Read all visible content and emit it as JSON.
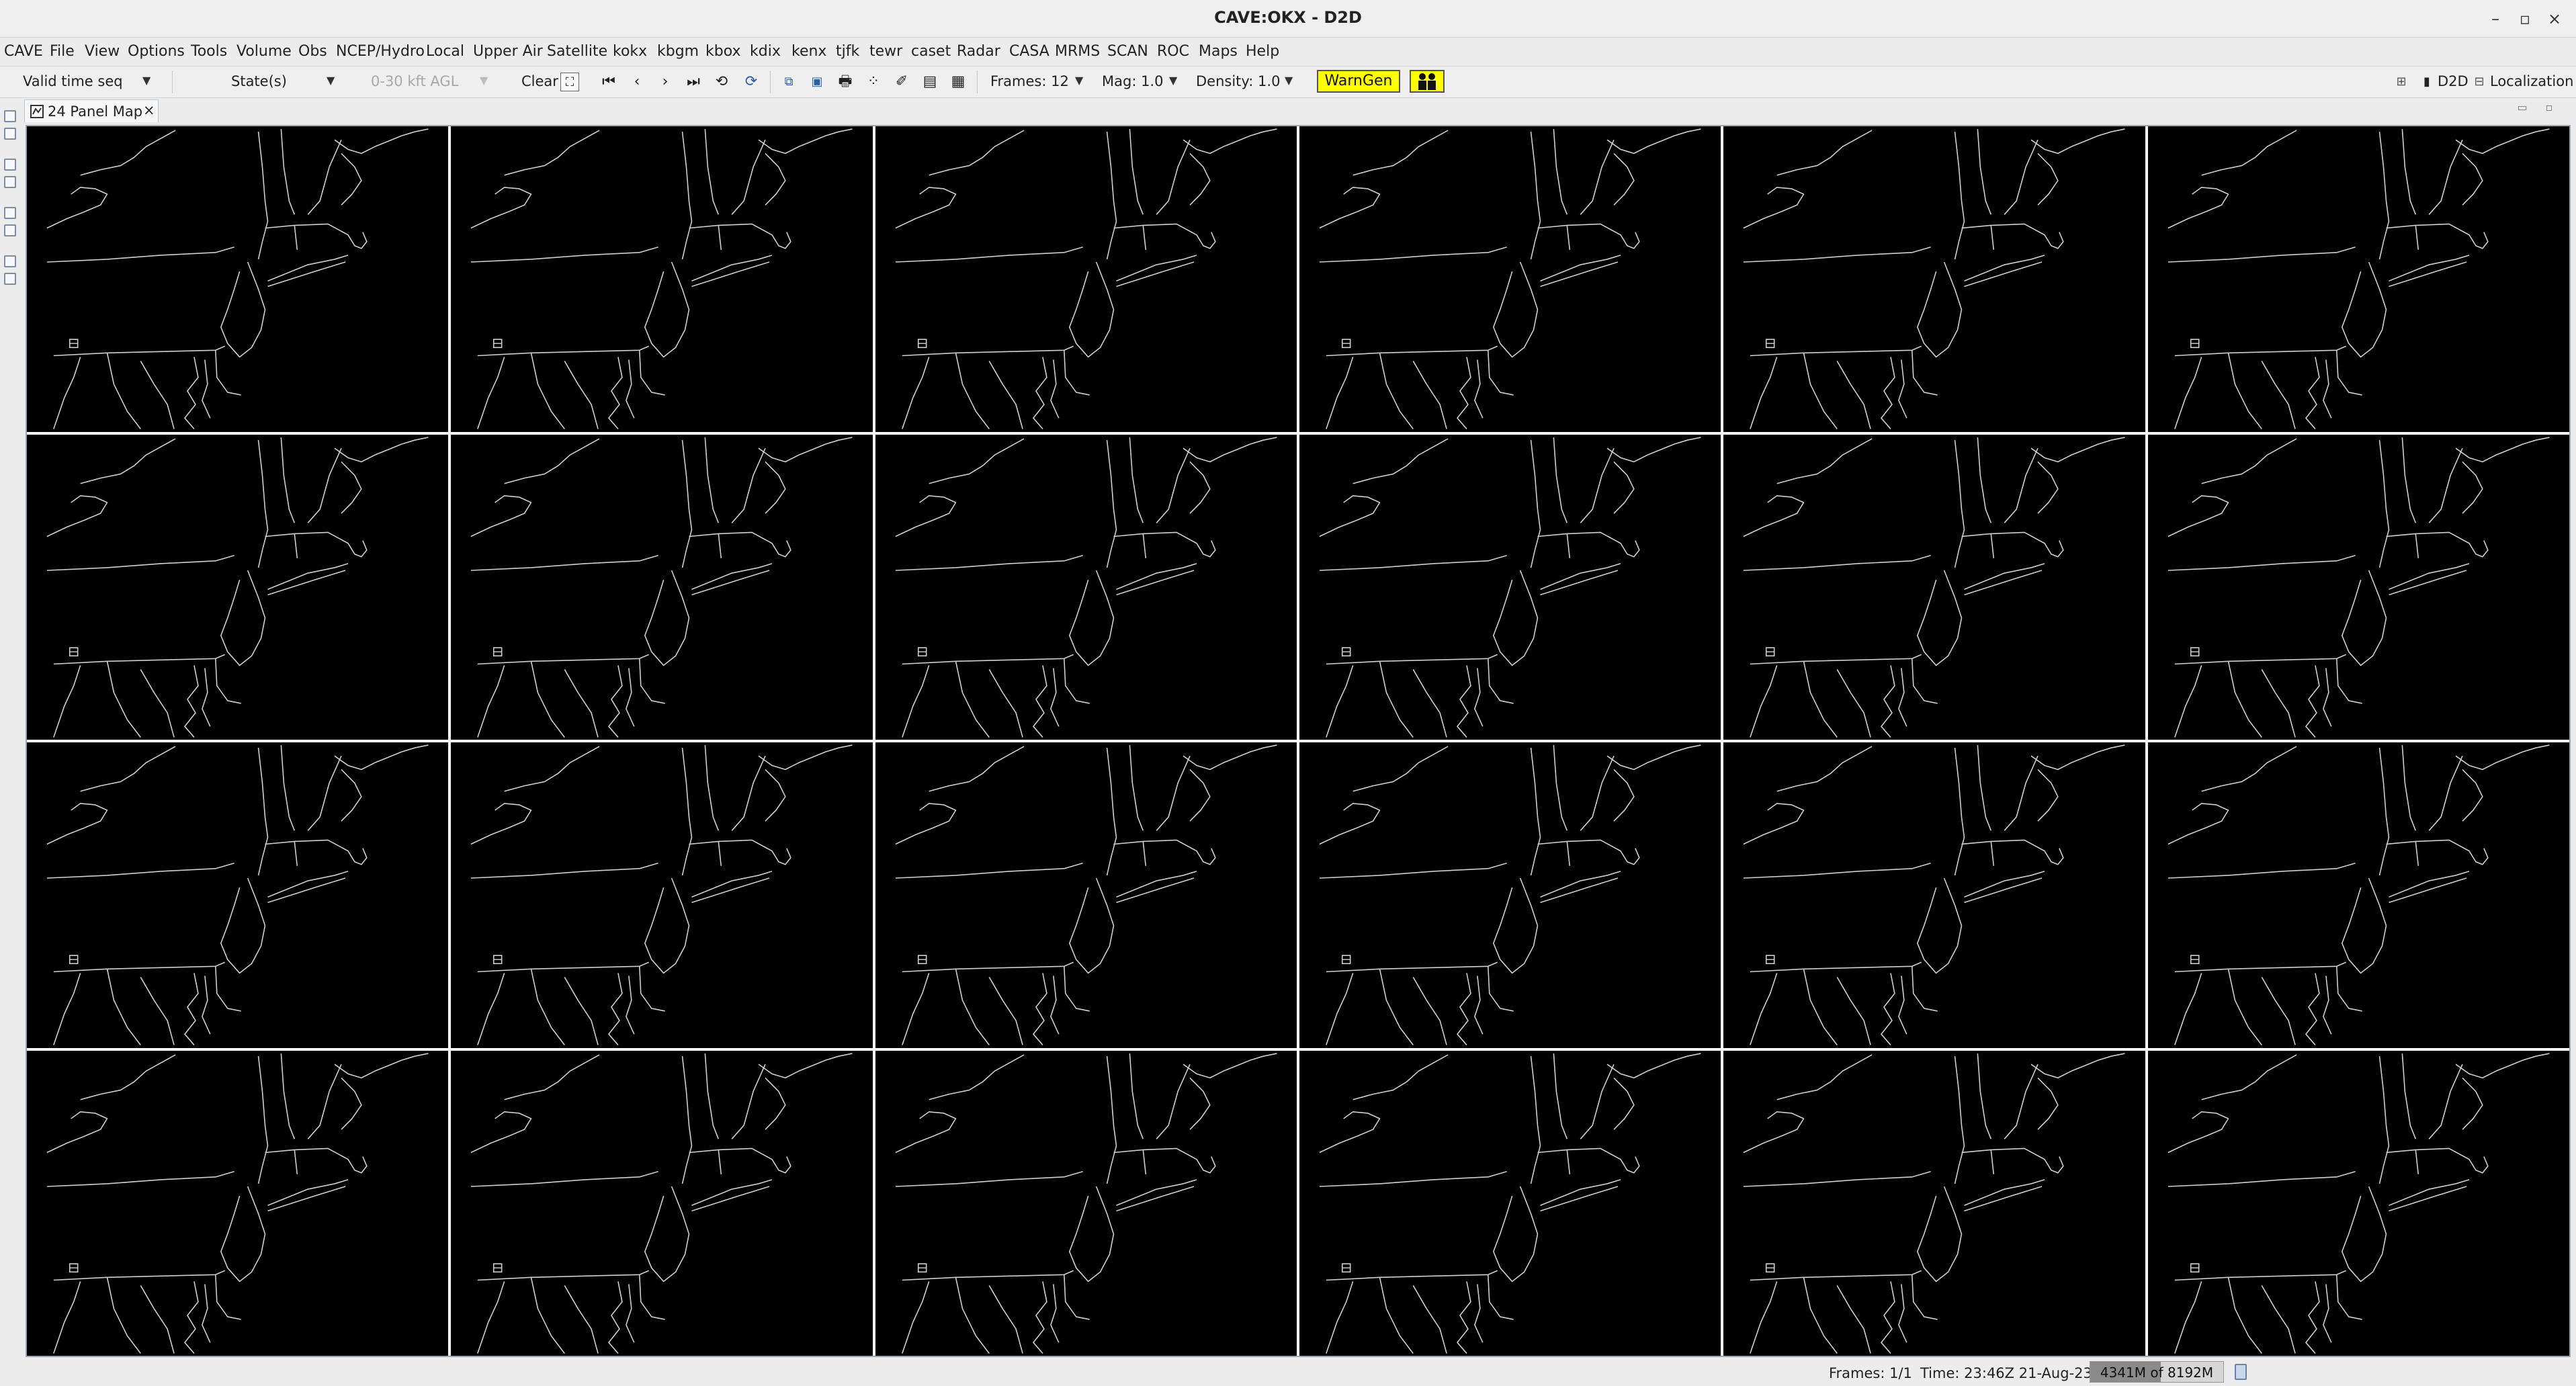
{
  "window": {
    "title": "CAVE:OKX - D2D",
    "controls": [
      "–",
      "▫",
      "×"
    ]
  },
  "menu": [
    "CAVE",
    "File",
    "View",
    "Options",
    "Tools",
    "Volume",
    "Obs",
    "NCEP/Hydro",
    "Local",
    "Upper Air",
    "Satellite",
    "kokx",
    "kbgm",
    "kbox",
    "kdix",
    "kenx",
    "tjfk",
    "tewr",
    "caset",
    "Radar",
    "CASA",
    "MRMS",
    "SCAN",
    "ROC",
    "Maps",
    "Help"
  ],
  "toolbar": {
    "time_mode": "Valid time seq",
    "states": "State(s)",
    "height_range": "0-30 kft AGL",
    "clear": "Clear",
    "frames": "Frames: 12",
    "mag": "Mag: 1.0",
    "density": "Density: 1.0",
    "warngen": "WarnGen",
    "perspective_d2d": "D2D",
    "perspective_localization": "Localization"
  },
  "icons": {
    "first_frame": "⏮",
    "prev_frame": "‹",
    "next_frame": "›",
    "last_frame": "⏭",
    "loop": "⟲",
    "refresh": "⟳",
    "print": "🖶"
  },
  "tab": {
    "label": "24 Panel Map",
    "close": "×"
  },
  "panels": {
    "rows": 4,
    "cols": 6
  },
  "status": {
    "frames": "Frames: 1/1",
    "time": "Time: 23:46Z 21-Aug-23",
    "memory": "4341M of 8192M",
    "memory_used_fraction": 0.53
  },
  "colors": {
    "warngen_bg": "#ffff00",
    "map_bg": "#000000",
    "map_lines": "#cfcfcf"
  }
}
